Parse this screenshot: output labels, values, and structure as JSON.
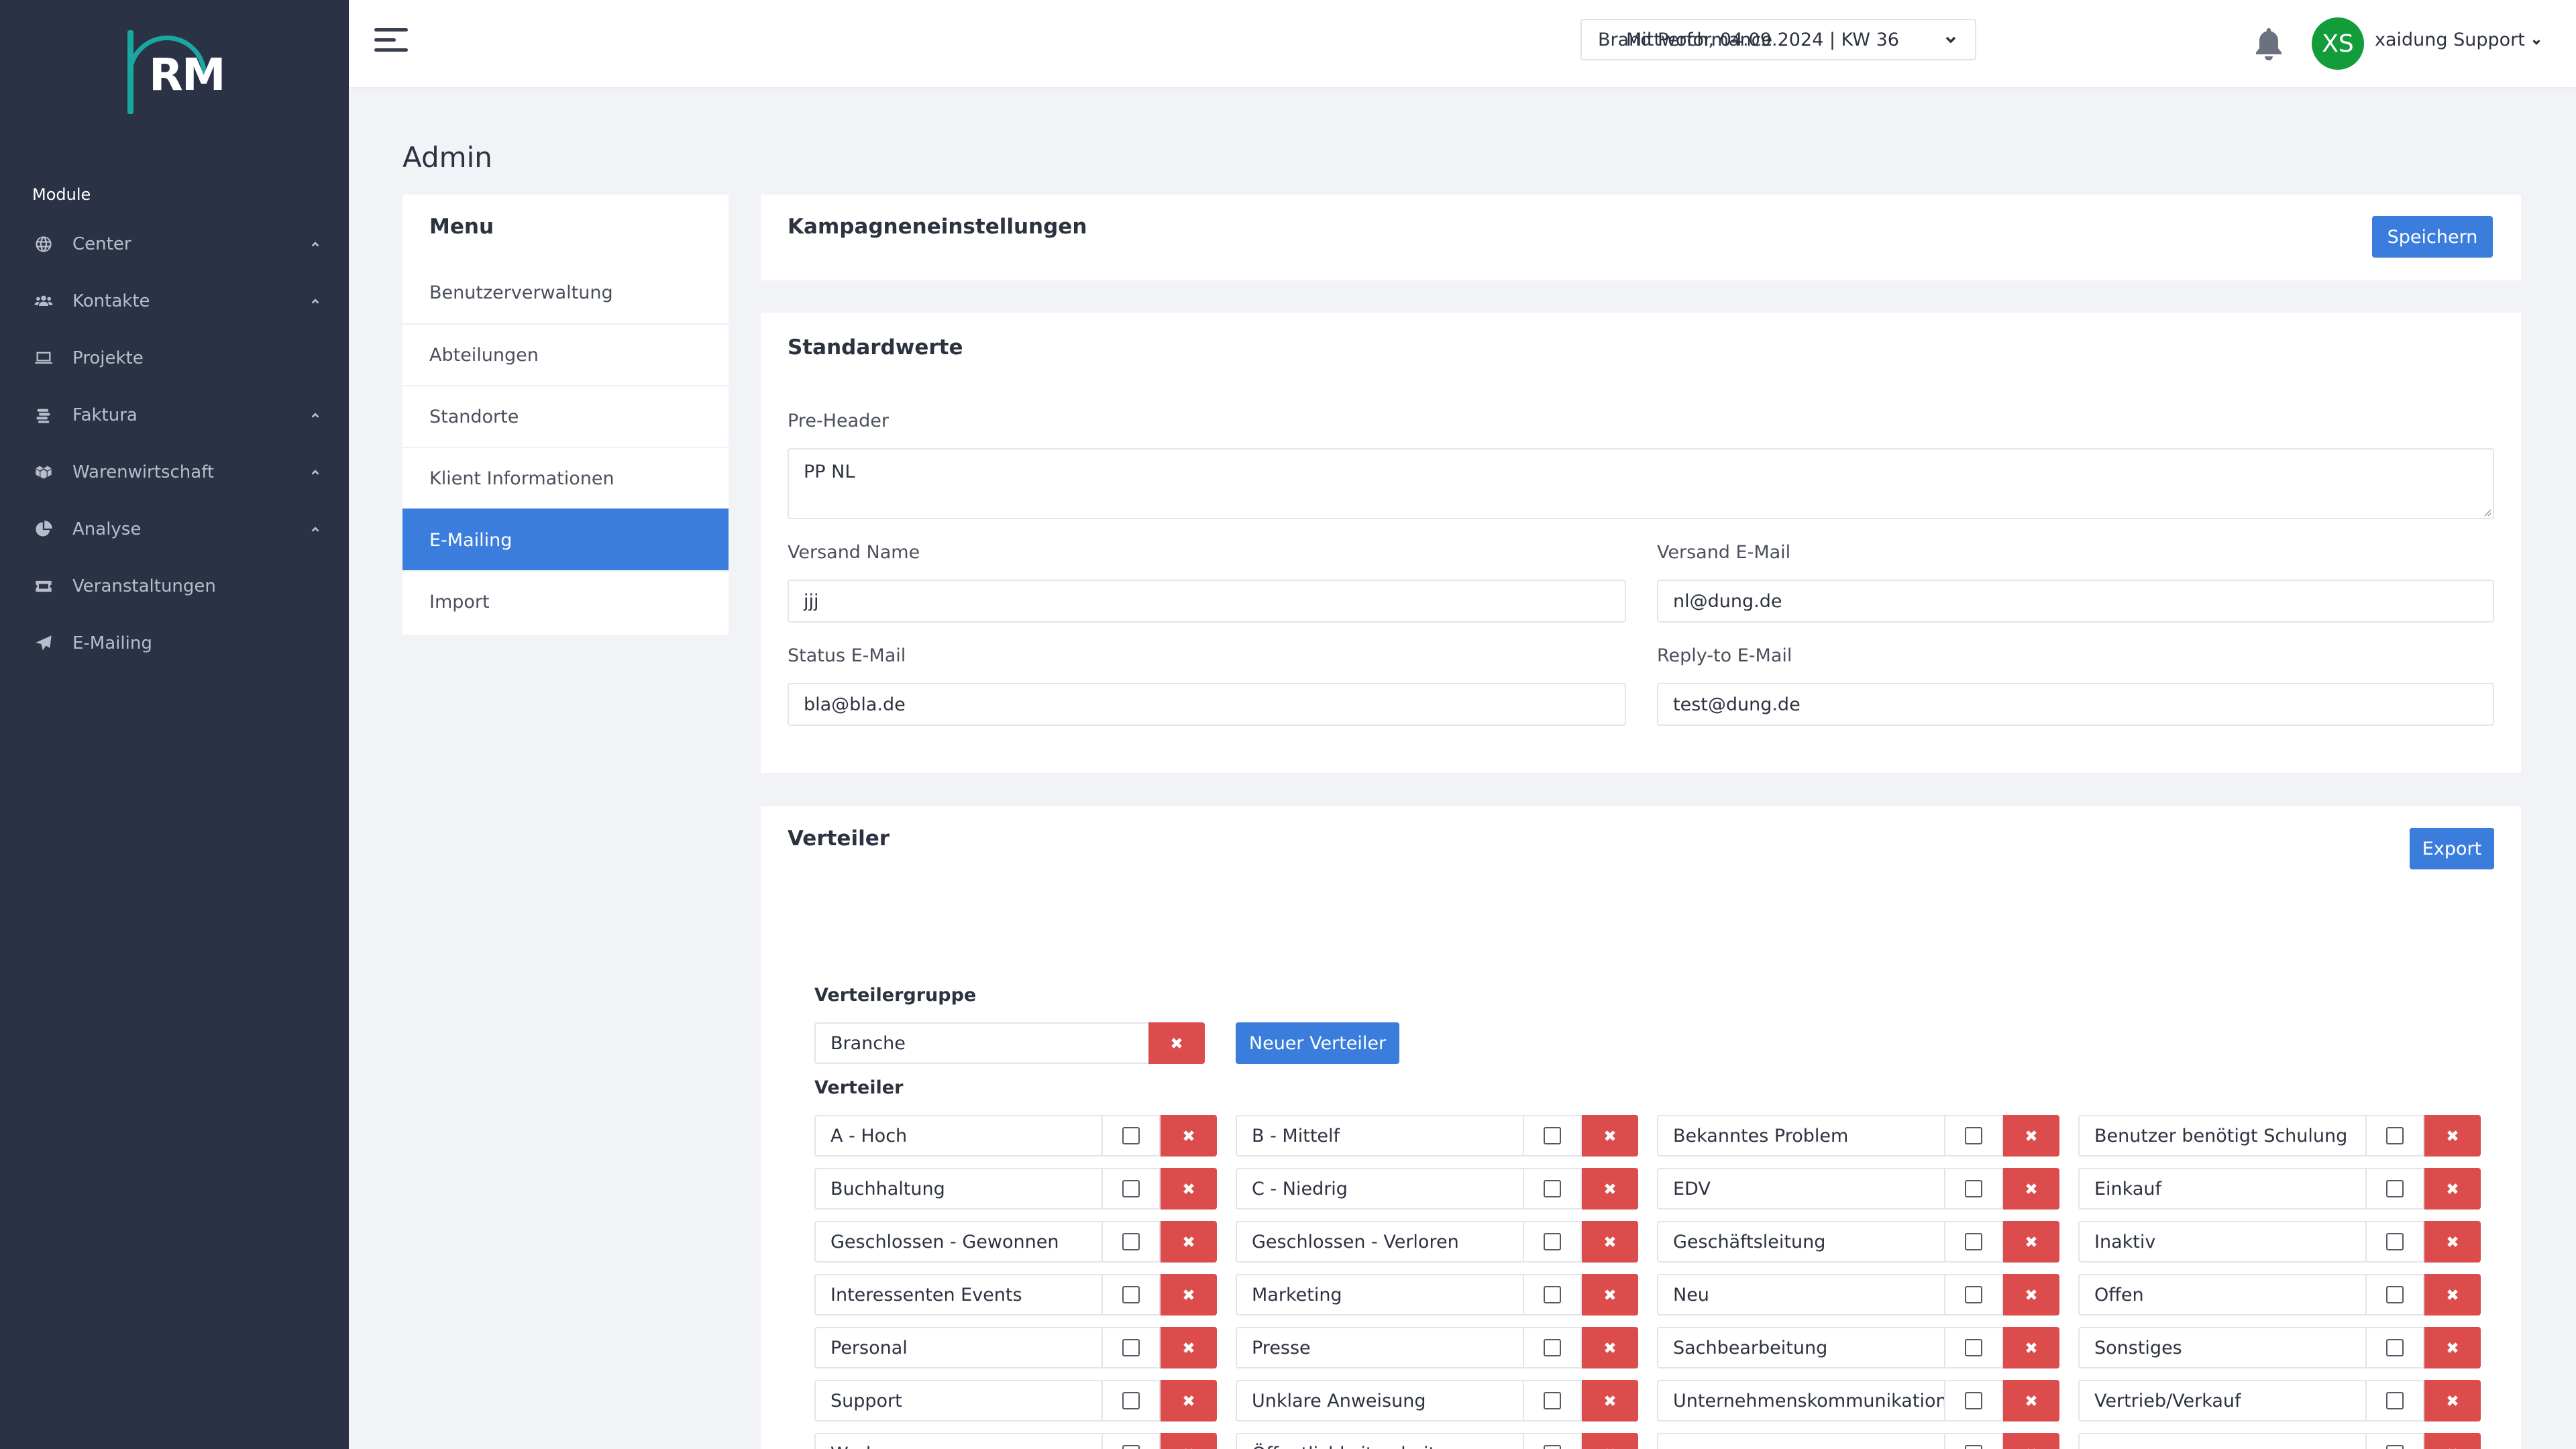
{
  "sidebar": {
    "logo_text": "RM",
    "module_label": "Module",
    "items": [
      {
        "label": "Center",
        "icon": "globe-icon",
        "has_chevron": true
      },
      {
        "label": "Kontakte",
        "icon": "users-icon",
        "has_chevron": true
      },
      {
        "label": "Projekte",
        "icon": "laptop-icon",
        "has_chevron": false
      },
      {
        "label": "Faktura",
        "icon": "coins-icon",
        "has_chevron": true
      },
      {
        "label": "Warenwirtschaft",
        "icon": "boxes-icon",
        "has_chevron": true
      },
      {
        "label": "Analyse",
        "icon": "pie-chart-icon",
        "has_chevron": true
      },
      {
        "label": "Veranstaltungen",
        "icon": "ticket-icon",
        "has_chevron": false
      },
      {
        "label": "E-Mailing",
        "icon": "paper-plane-icon",
        "has_chevron": false
      }
    ]
  },
  "topbar": {
    "brand_select": "Brand Performance",
    "date_text": "Mittwoch, 04.09.2024 | KW 36",
    "avatar_initials": "XS",
    "user_name": "xaidung Support"
  },
  "page": {
    "title": "Admin"
  },
  "menu": {
    "title": "Menu",
    "items": [
      "Benutzerverwaltung",
      "Abteilungen",
      "Standorte",
      "Klient Informationen",
      "E-Mailing",
      "Import"
    ],
    "active": "E-Mailing"
  },
  "kampagne": {
    "title": "Kampagneneinstellungen",
    "save_label": "Speichern"
  },
  "standard": {
    "title": "Standardwerte",
    "preheader_label": "Pre-Header",
    "preheader_value": "PP NL",
    "versand_name_label": "Versand Name",
    "versand_name_value": "jjj",
    "versand_email_label": "Versand E-Mail",
    "versand_email_value": "nl@dung.de",
    "status_email_label": "Status E-Mail",
    "status_email_value": "bla@bla.de",
    "replyto_label": "Reply-to E-Mail",
    "replyto_value": "test@dung.de"
  },
  "verteiler": {
    "title": "Verteiler",
    "export_label": "Export",
    "gruppe_label": "Verteilergruppe",
    "gruppe_value": "Branche",
    "neuer_label": "Neuer Verteiler",
    "list_label": "Verteiler",
    "items": [
      "A - Hoch",
      "B - Mittelf",
      "Bekanntes Problem",
      "Benutzer benötigt Schulung",
      "Buchhaltung",
      "C - Niedrig",
      "EDV",
      "Einkauf",
      "Geschlossen - Gewonnen",
      "Geschlossen - Verloren",
      "Geschäftsleitung",
      "Inaktiv",
      "Interessenten Events",
      "Marketing",
      "Neu",
      "Offen",
      "Personal",
      "Presse",
      "Sachbearbeitung",
      "Sonstiges",
      "Support",
      "Unklare Anweisung",
      "Unternehmenskommunikation",
      "Vertrieb/Verkauf",
      "Werbung",
      "Öffentlichkeitsarbeit",
      "",
      ""
    ]
  }
}
